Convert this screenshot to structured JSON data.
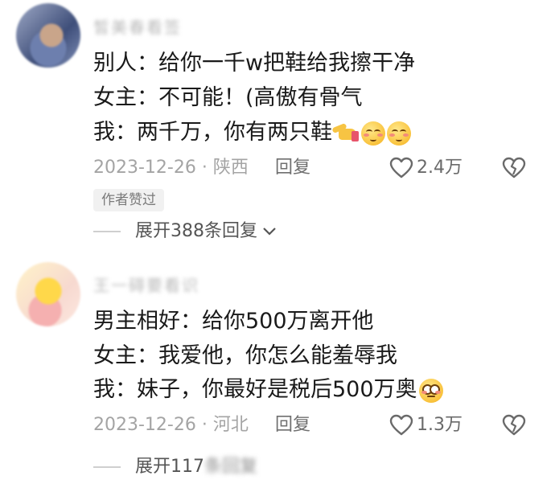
{
  "comments": [
    {
      "username": "皙美春看签",
      "lines": [
        "别人：给你一千w把鞋给我擦干净",
        "女主：不可能！(高傲有骨气",
        "我：两千万，你有两只鞋"
      ],
      "date": "2023-12-26",
      "location": "陕西",
      "reply_label": "回复",
      "likes": "2.4万",
      "badge": "作者赞过",
      "expand_label": "展开388条回复",
      "emojis": [
        "pointing-hand-icon",
        "relieved-face-icon",
        "relieved-face-icon"
      ]
    },
    {
      "username": "王一碍要看识",
      "lines": [
        "男主相好：给你500万离开他",
        "女主：我爱他，你怎么能羞辱我",
        "我：妹子，你最好是税后500万奥"
      ],
      "date": "2023-12-26",
      "location": "河北",
      "reply_label": "回复",
      "likes": "1.3万",
      "expand_label": "展开117",
      "expand_blurred": "条回复",
      "emojis": [
        "flushed-face-icon"
      ]
    }
  ]
}
